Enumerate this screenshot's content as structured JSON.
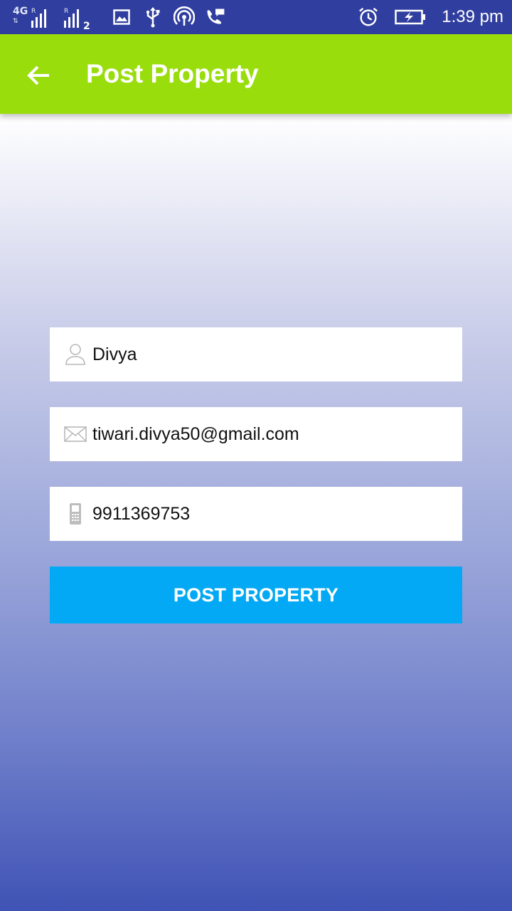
{
  "status_bar": {
    "network_type": "4G",
    "roaming_1": "R",
    "roaming_2": "R",
    "sim_slot": "2",
    "time": "1:39 pm",
    "icons": [
      "signal-icon",
      "image-icon",
      "usb-icon",
      "hotspot-icon",
      "call-icon",
      "alarm-icon",
      "battery-charging-icon"
    ]
  },
  "app_bar": {
    "title": "Post Property",
    "back_icon": "arrow-left-icon",
    "color": "#99dd0d"
  },
  "form": {
    "name": {
      "value": "Divya",
      "icon": "person-icon"
    },
    "email": {
      "value": "tiwari.divya50@gmail.com",
      "icon": "mail-icon"
    },
    "phone": {
      "value": "9911369753",
      "icon": "mobile-phone-icon"
    },
    "submit_label": "POST PROPERTY",
    "submit_color": "#03a9f4"
  }
}
